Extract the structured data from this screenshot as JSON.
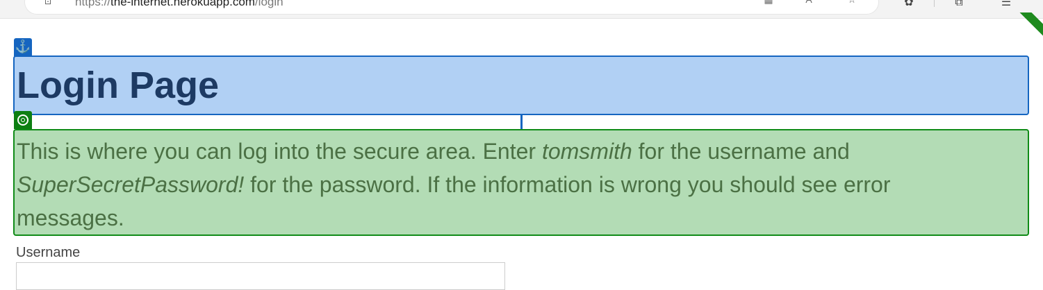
{
  "browser": {
    "url_scheme": "https://",
    "url_host": "the-internet.herokuapp.com",
    "url_path": "/login"
  },
  "page": {
    "heading": "Login Page",
    "intro": {
      "part1": "This is where you can log into the secure area. Enter ",
      "username_hint": "tomsmith",
      "part2": " for the username and ",
      "password_hint": "SuperSecretPassword!",
      "part3": " for the password. If the information is wrong you should see error messages."
    },
    "username_label": "Username",
    "username_value": ""
  },
  "overlay": {
    "anchor_icon": "anchor-icon",
    "target_icon": "target-icon",
    "heading_color": "#1565c0",
    "paragraph_color": "#108b17"
  }
}
